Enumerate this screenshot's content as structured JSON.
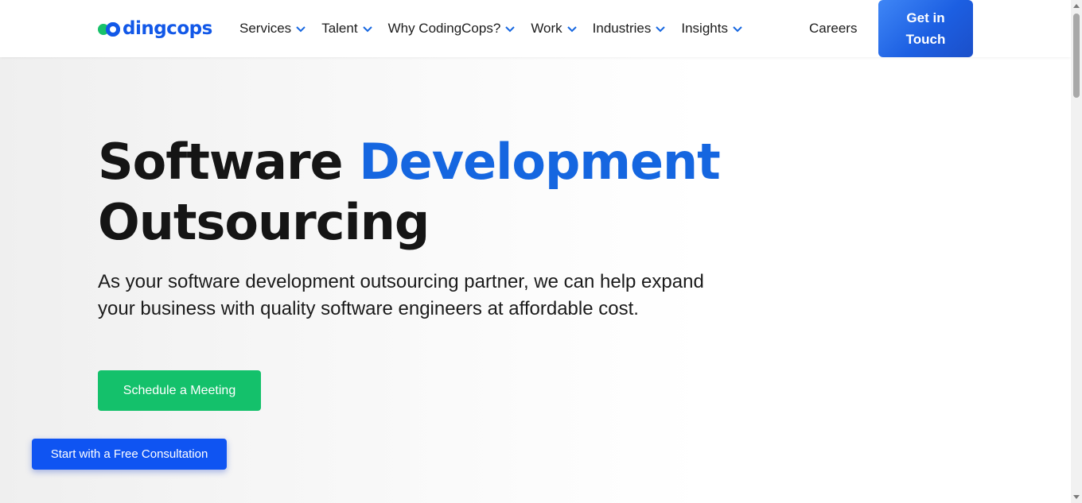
{
  "brand": {
    "logo_text": "dingcops",
    "logo_alt": "codingcops",
    "primary_color": "#1258e8",
    "green_color": "#14c16b"
  },
  "nav": {
    "items": [
      {
        "label": "Services",
        "icon": "chevron-down-icon"
      },
      {
        "label": "Talent",
        "icon": "chevron-down-icon"
      },
      {
        "label": "Why CodingCops?",
        "icon": "chevron-down-icon"
      },
      {
        "label": "Work",
        "icon": "chevron-down-icon"
      },
      {
        "label": "Industries",
        "icon": "chevron-down-icon"
      },
      {
        "label": "Insights",
        "icon": "chevron-down-icon"
      }
    ],
    "careers_label": "Careers",
    "cta_line1": "Get in",
    "cta_line2": "Touch"
  },
  "hero": {
    "title_part1": "Software ",
    "title_accent": "Development",
    "title_part2": "Outsourcing",
    "subtitle": "As your software development outsourcing partner, we can help expand your business with quality software engineers at affordable cost.",
    "meeting_button": "Schedule a Meeting",
    "accent_color": "#1566e0"
  },
  "floating": {
    "consult_button": "Start with a Free Consultation",
    "color": "#0f54f2"
  }
}
